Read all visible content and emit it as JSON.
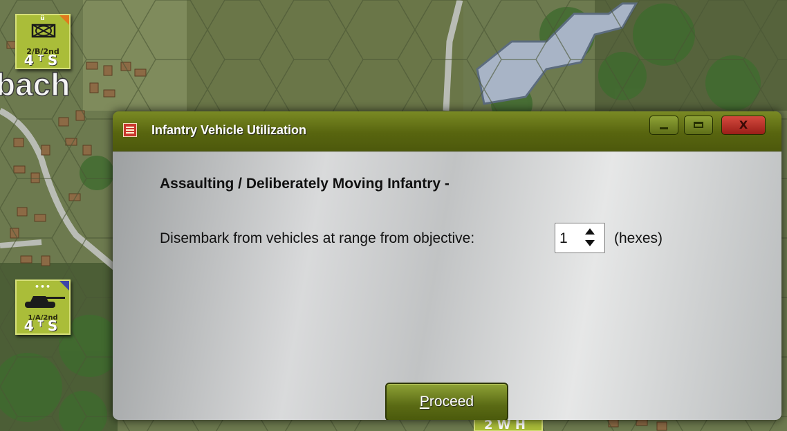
{
  "map": {
    "town_label": "bach",
    "bottom_counter_stats": "2 W H"
  },
  "counters": [
    {
      "unit": "2/B/2nd",
      "stats_left": "4",
      "stats_mid": "T",
      "stats_right": "S",
      "marker": "ü",
      "corner_color": "#e07a1d"
    },
    {
      "unit": "1/A/2nd",
      "stats_left": "4",
      "stats_mid": "T",
      "stats_right": "S",
      "marker": "•••",
      "corner_color": "#3b46a8"
    }
  ],
  "dialog": {
    "title": "Infantry Vehicle Utilization",
    "close_glyph": "X",
    "heading": "Assaulting / Deliberately Moving Infantry -",
    "disembark_label": "Disembark from vehicles at range from objective:",
    "disembark_value": "1",
    "units_label": "(hexes)",
    "proceed_label": "Proceed"
  },
  "colors": {
    "titlebar": "#5e6b14",
    "close_button": "#c0392b",
    "counter_green": "#aabd39"
  }
}
